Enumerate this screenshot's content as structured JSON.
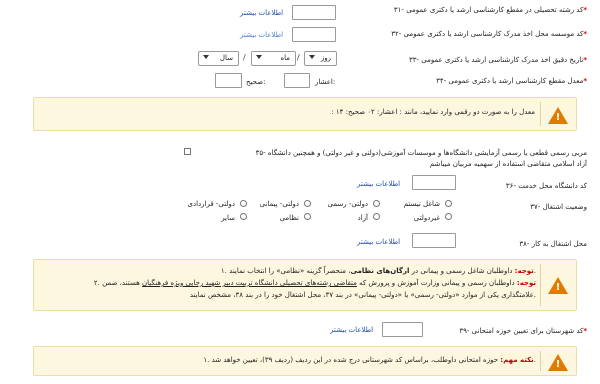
{
  "q31": {
    "label": "۳۱- کد رشته تحصیلی در مقطع کارشناسی ارشد یا دکتری عمومی",
    "star": "*",
    "link": "اطلاعات بیشتر"
  },
  "q32": {
    "label": "۳۲- کد موسسه محل اخذ مدرک کارشناسی ارشد یا دکتری عمومی",
    "star": "*",
    "link": "اطلاعات بیشتر"
  },
  "q33": {
    "label": "۳۳- تاریخ دقیق اخذ مدرک کارشناسی ارشد یا دکتری عمومی",
    "star": "*",
    "day": "روز",
    "month": "ماه",
    "year": "سال",
    "slash": "/"
  },
  "q34": {
    "label": "۳۴- معدل مقطع کارشناسی ارشد یا دکتری عمومی",
    "star": "*",
    "ashar_label": "اعشار:",
    "sahih_label": "صحیح:"
  },
  "warn1": {
    "text": ": معدل را به صورت دو رقمی وارد نمایید، مانند : اعشار: ۰۲ صحیح: ۱۴"
  },
  "q35": {
    "line1": "۳۵- مربی رسمی قطعی یا رسمی آزمایشی دانشگاه‌ها و موسسات آموزشی(دولتی و غیر دولتی) و همچنین دانشگاه",
    "line2": "آزاد اسلامی متقاضی استفاده از سهمیه مربیان میباشم"
  },
  "q36": {
    "label": "۳۶- کد دانشگاه محل خدمت",
    "link": "اطلاعات بیشتر"
  },
  "q37": {
    "label": "۳۷- وضعیت اشتغال",
    "options_row1": [
      "شاغل نیستم",
      "دولتی- رسمی",
      "دولتی- پیمانی",
      "دولتی- قراردادی"
    ],
    "options_row2": [
      "غیردولتی",
      "آزاد",
      "نظامی",
      "سایر"
    ]
  },
  "q38": {
    "label": "۳۸- محل اشتغال به کار",
    "link": "اطلاعات بیشتر"
  },
  "warn2": {
    "note1_bullet": "۱.",
    "note1_prefix": "توجه:",
    "note1_text_a": " داوطلبان شاغل رسمی و پیمانی در ",
    "note1_bold": "ارگان‌های نظامی",
    "note1_text_b": "، منحصراً گزینه «نظامی» را انتخاب نمایند.",
    "note2_bullet": "۲.",
    "note2_prefix": "توجه:",
    "note2_text_a": " داوطلبان رسمی و پیمانی وزارت آموزش و پرورش که ",
    "note2_ul": "متقاضی رشته‌های تحصیلی دانشگاه تربیت دبیر شهید رجایی ویژه فرهنگیان",
    "note2_text_b": " هستند، ضمن",
    "note2_line2": "علامتگذاری یکی از موارد «دولتی- رسمی» یا «دولتی- پیمانی» در بند ۳۷، محل اشتغال خود را در بند ۳۸، مشخص نمایند."
  },
  "q39": {
    "label": "۳۹- کد شهرستان برای تعیین حوزه امتحانی",
    "star": "*",
    "link": "اطلاعات بیشتر"
  },
  "warn3": {
    "bullet": "۱.",
    "prefix": "نکته مهم:",
    "text": " حوزه امتحانی داوطلب، براساس کد شهرستانی درج شده در این ردیف (ردیف ۳۹)، تعیین خواهد شد."
  },
  "colors": {
    "warn_bg": "#fdf7df",
    "link": "#1f4fa6",
    "required": "#d00000",
    "warn_icon": "#e07b00"
  },
  "icons": {
    "warning": "warning-triangle-icon"
  }
}
